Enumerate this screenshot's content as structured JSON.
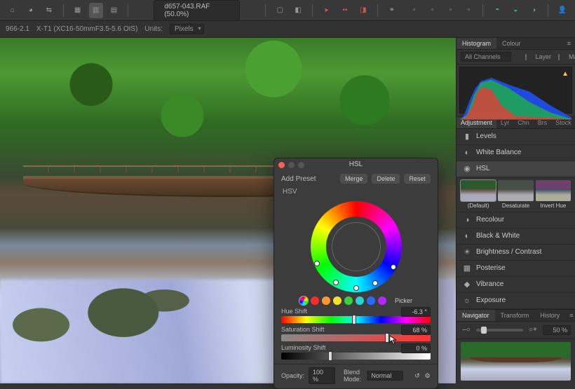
{
  "doc": {
    "name": "d657-043.RAF (50.0%)"
  },
  "context": {
    "bits": "966-2.1",
    "lens": "X-T1 (XC16-50mmF3.5-5.6 OIS)",
    "units_label": "Units:",
    "units_value": "Pixels"
  },
  "hsl": {
    "title": "HSL",
    "add_preset": "Add Preset",
    "merge": "Merge",
    "delete": "Delete",
    "reset": "Reset",
    "hsv": "HSV",
    "picker": "Picker",
    "swatches": [
      "#ff2a2a",
      "#ff9a2a",
      "#f2e22a",
      "#3ad23a",
      "#2ad2d2",
      "#2a6aff",
      "#b02aff",
      "#ff2ac0"
    ],
    "hue": {
      "label": "Hue Shift",
      "value": "-6.3 °",
      "pos": 49
    },
    "saturation": {
      "label": "Saturation Shift",
      "value": "68 %",
      "pos": 71
    },
    "luminosity": {
      "label": "Luminosity Shift",
      "value": "0 %",
      "pos": 33
    },
    "opacity_label": "Opacity:",
    "opacity_value": "100 %",
    "blend_label": "Blend Mode:",
    "blend_value": "Normal"
  },
  "right": {
    "tabs_top": {
      "histogram": "Histogram",
      "colour": "Colour"
    },
    "channels_label": "All Channels",
    "layer": "Layer",
    "marquee": "Marquee",
    "tabs_adj": {
      "adjustment": "Adjustment",
      "lyr": "Lyr",
      "chn": "Chn",
      "brs": "Brs",
      "stock": "Stock"
    },
    "adj_list": [
      "Levels",
      "White Balance",
      "HSL",
      "Recolour",
      "Black & White",
      "Brightness / Contrast",
      "Posterise",
      "Vibrance",
      "Exposure"
    ],
    "presets": {
      "default": "(Default)",
      "desaturate": "Desaturate",
      "invert": "Invert Hue"
    },
    "tabs_nav": {
      "navigator": "Navigator",
      "transform": "Transform",
      "history": "History"
    },
    "zoom": "50 %"
  },
  "icons": {
    "adj": [
      "▮",
      "◐",
      "◉",
      "◑",
      "◐",
      "☀",
      "▦",
      "◆",
      "☼"
    ]
  }
}
